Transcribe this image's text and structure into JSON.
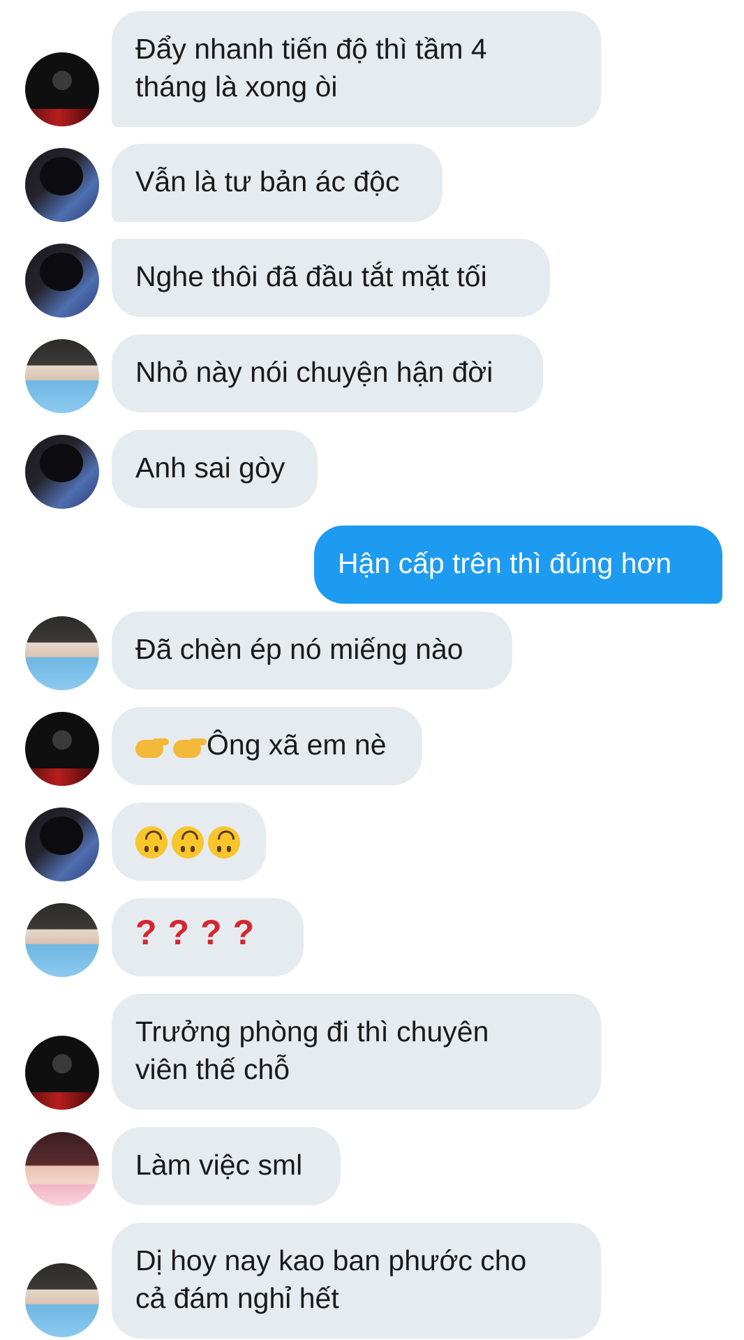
{
  "conversation": {
    "messages": [
      {
        "sender": "other",
        "avatar": "black-outfit-avatar",
        "lines": [
          "Đẩy nhanh tiến độ thì tầm 4",
          "tháng là xong òi"
        ]
      },
      {
        "sender": "other",
        "avatar": "headphones-avatar",
        "lines": [
          "Vẫn là tư bản ác độc"
        ]
      },
      {
        "sender": "other",
        "avatar": "headphones-avatar",
        "lines": [
          "Nghe thôi đã đầu tắt mặt tối"
        ]
      },
      {
        "sender": "other",
        "avatar": "blue-scarf-avatar",
        "lines": [
          "Nhỏ này nói chuyện hận đời"
        ]
      },
      {
        "sender": "other",
        "avatar": "headphones-avatar",
        "lines": [
          "Anh sai gòy"
        ]
      },
      {
        "sender": "me",
        "lines": [
          "Hận cấp trên thì đúng hơn"
        ]
      },
      {
        "sender": "other",
        "avatar": "blue-scarf-avatar",
        "lines": [
          "Đã chèn ép nó miếng nào"
        ]
      },
      {
        "sender": "other",
        "avatar": "black-outfit-avatar",
        "emoji": "pointing-right-hands-icon",
        "lines": [
          "Ông xã em nè"
        ]
      },
      {
        "sender": "other",
        "avatar": "headphones-avatar",
        "emoji": "upside-down-face-icon",
        "emoji_count": 3
      },
      {
        "sender": "other",
        "avatar": "blue-scarf-avatar",
        "text_glyphs": [
          "?",
          "?",
          "?",
          "?"
        ]
      },
      {
        "sender": "other",
        "avatar": "black-outfit-avatar",
        "lines": [
          "Trưởng phòng đi thì chuyên",
          "viên thế chỗ"
        ]
      },
      {
        "sender": "other",
        "avatar": "pink-jacket-avatar",
        "lines": [
          "Làm việc sml"
        ]
      },
      {
        "sender": "other",
        "avatar": "blue-scarf-avatar",
        "lines": [
          "Dị hoy nay kao ban phước cho",
          "cả đám nghỉ hết"
        ]
      }
    ]
  },
  "colors": {
    "incoming_bubble": "#e6ebf0",
    "outgoing_bubble": "#1d9bf0",
    "incoming_text": "#1a1a1a",
    "outgoing_text": "#ffffff",
    "question_mark": "#d3272f"
  }
}
